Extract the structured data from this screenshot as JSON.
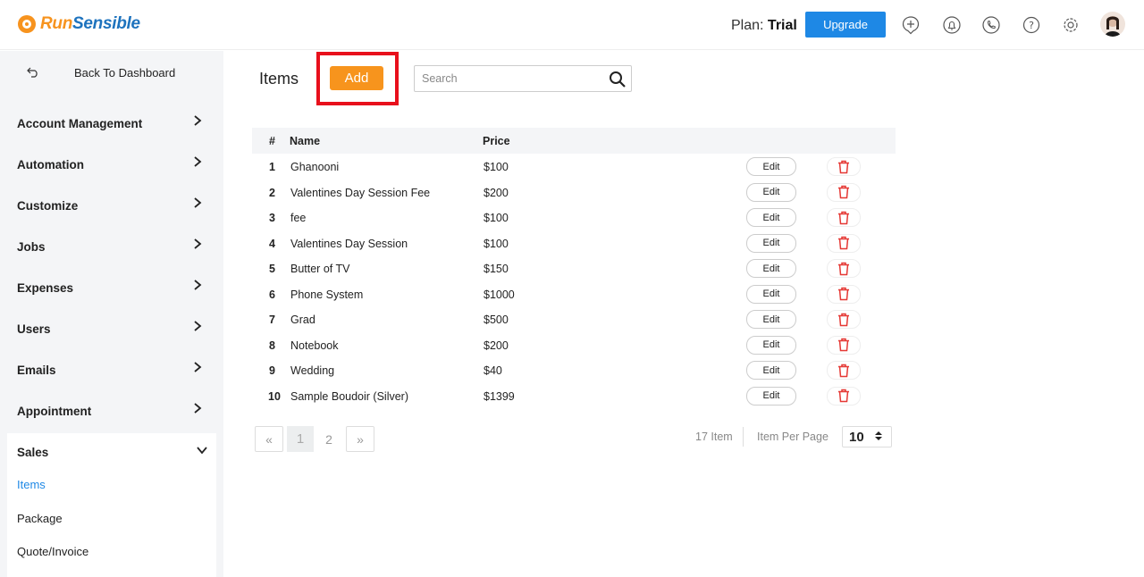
{
  "brand": {
    "run": "Run",
    "sensible": "Sensible"
  },
  "header": {
    "plan_label": "Plan:",
    "plan_value": "Trial",
    "upgrade_label": "Upgrade",
    "icons": [
      "add-circle-icon",
      "bell-icon",
      "phone-icon",
      "help-icon",
      "gear-icon"
    ]
  },
  "sidebar": {
    "back_label": "Back To Dashboard",
    "items": [
      {
        "label": "Account Management"
      },
      {
        "label": "Automation"
      },
      {
        "label": "Customize"
      },
      {
        "label": "Jobs"
      },
      {
        "label": "Expenses"
      },
      {
        "label": "Users"
      },
      {
        "label": "Emails"
      },
      {
        "label": "Appointment"
      }
    ],
    "sales": {
      "label": "Sales",
      "sub_items": [
        {
          "label": "Items",
          "active": true
        },
        {
          "label": "Package",
          "active": false
        },
        {
          "label": "Quote/Invoice",
          "active": false
        }
      ]
    }
  },
  "main": {
    "title": "Items",
    "add_label": "Add",
    "search_placeholder": "Search",
    "table": {
      "headers": {
        "num": "#",
        "name": "Name",
        "price": "Price"
      },
      "edit_label": "Edit",
      "rows": [
        {
          "num": "1",
          "name": "Ghanooni",
          "price": "$100"
        },
        {
          "num": "2",
          "name": "Valentines Day Session Fee",
          "price": "$200"
        },
        {
          "num": "3",
          "name": "fee",
          "price": "$100"
        },
        {
          "num": "4",
          "name": "Valentines Day Session",
          "price": "$100"
        },
        {
          "num": "5",
          "name": "Butter of TV",
          "price": "$150"
        },
        {
          "num": "6",
          "name": "Phone System",
          "price": "$1000"
        },
        {
          "num": "7",
          "name": "Grad",
          "price": "$500"
        },
        {
          "num": "8",
          "name": "Notebook",
          "price": "$200"
        },
        {
          "num": "9",
          "name": "Wedding",
          "price": "$40"
        },
        {
          "num": "10",
          "name": "Sample Boudoir (Silver)",
          "price": "$1399"
        }
      ]
    },
    "pagination": {
      "prev": "«",
      "pages": [
        "1",
        "2"
      ],
      "current": "1",
      "next": "»",
      "count_text": "17 Item",
      "per_page_label": "Item Per Page",
      "per_page_value": "10"
    }
  },
  "colors": {
    "accent": "#1e88e5",
    "add": "#f7941d",
    "brand_orange": "#f7931e",
    "highlight": "#e8101c",
    "delete": "#e53935"
  }
}
